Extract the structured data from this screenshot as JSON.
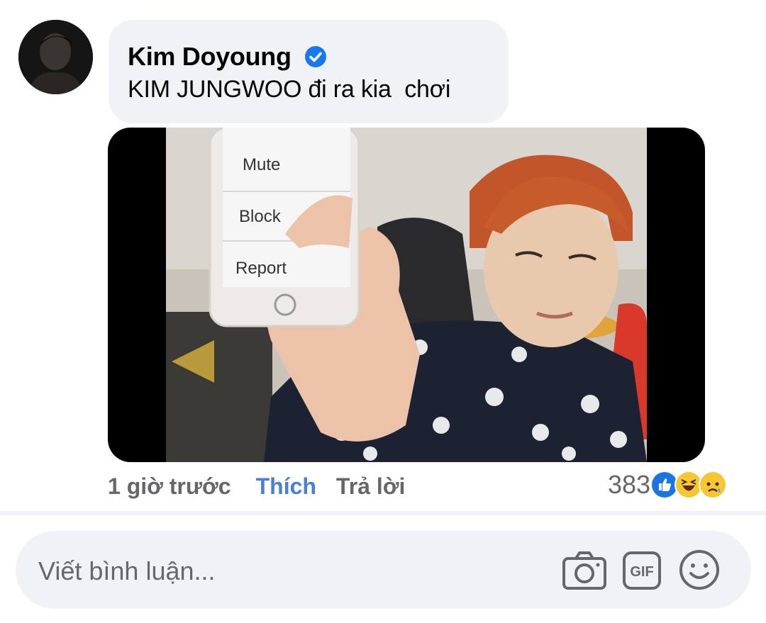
{
  "comment": {
    "author": "Kim Doyoung",
    "text": "KIM JUNGWOO đi ra kia  chơi",
    "avatar_icon": "avatar",
    "verified_icon": "verified-badge-icon",
    "image": {
      "menu_items": [
        "Mute",
        "Block",
        "Report"
      ]
    }
  },
  "actions": {
    "time": "1 giờ trước",
    "like_label": "Thích",
    "reply_label": "Trả lời",
    "like_color": "#4a7fd4"
  },
  "reactions": {
    "count": "383",
    "icons": [
      "like-reaction-icon",
      "haha-reaction-icon",
      "sad-reaction-icon"
    ]
  },
  "composer": {
    "placeholder": "Viết bình luận...",
    "tools": [
      "camera-icon",
      "gif-icon",
      "emoji-icon"
    ]
  },
  "colors": {
    "bubble_bg": "#f0f2f5",
    "verified": "#1877f2",
    "secondary_text": "#65676b"
  }
}
